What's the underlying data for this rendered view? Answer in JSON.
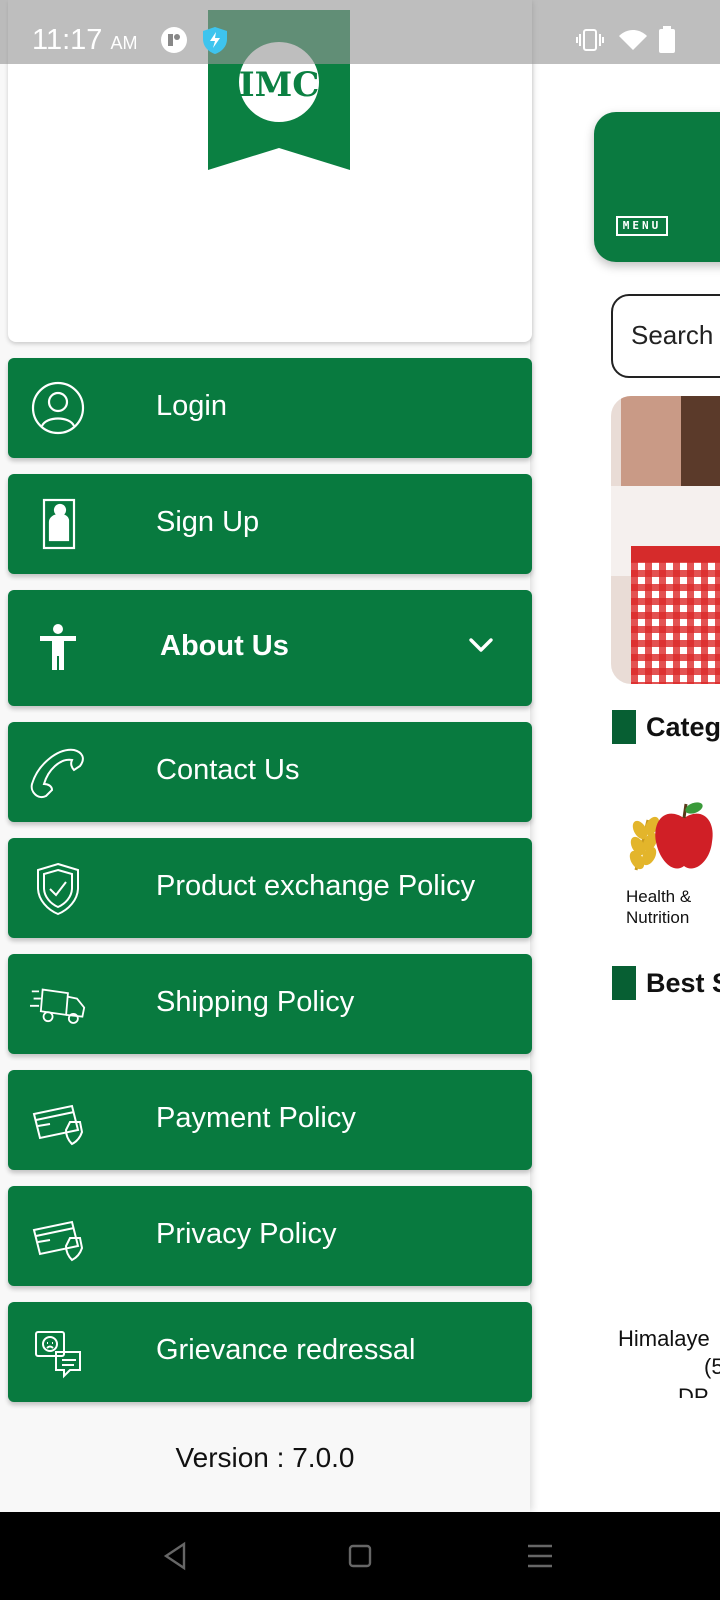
{
  "status_bar": {
    "time": "11:17",
    "ampm": "AM",
    "icons": [
      "privacy-dot-icon",
      "shield-bolt-icon",
      "vibrate-icon",
      "wifi-icon",
      "battery-icon"
    ]
  },
  "drawer": {
    "logo_text": "IMC",
    "menu": [
      {
        "id": "login",
        "label": "Login",
        "icon": "user-circle-icon"
      },
      {
        "id": "signup",
        "label": "Sign Up",
        "icon": "signup-card-icon"
      },
      {
        "id": "about",
        "label": "About Us",
        "icon": "person-accessibility-icon",
        "expandable": true
      },
      {
        "id": "contact",
        "label": "Contact Us",
        "icon": "phone-icon"
      },
      {
        "id": "exchange",
        "label": "Product exchange Policy",
        "icon": "shield-check-icon"
      },
      {
        "id": "shipping",
        "label": "Shipping Policy",
        "icon": "delivery-truck-icon"
      },
      {
        "id": "payment",
        "label": "Payment Policy",
        "icon": "credit-card-shield-icon"
      },
      {
        "id": "privacy",
        "label": "Privacy Policy",
        "icon": "credit-card-shield-icon"
      },
      {
        "id": "grievance",
        "label": "Grievance redressal",
        "icon": "chat-feedback-icon"
      }
    ],
    "version": "Version : 7.0.0"
  },
  "background_app": {
    "menu_tag": "MENU",
    "search_placeholder": "Search",
    "categories_title": "Categ",
    "category_item_label_1": "Health &",
    "category_item_label_2": "Nutrition",
    "best_sellers_title": "Best S",
    "product_name": "Himalaye",
    "product_sub": "(5",
    "product_dp": "DP :"
  },
  "colors": {
    "brand_green": "#087a3f",
    "dark_green": "#075f33"
  }
}
